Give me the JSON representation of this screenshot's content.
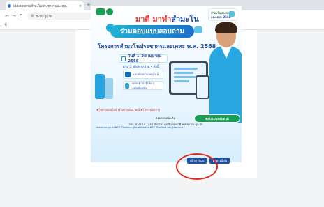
{
  "browser": {
    "tab_title": "แบบสอบถามสำมะโนประชากรและเคหะ",
    "tab_close": "×",
    "new_tab": "+",
    "back": "←",
    "forward": "→",
    "reload": "C",
    "address": "ระบบ.go.th",
    "apps_icon": "⠿"
  },
  "banner": {
    "logo_text": "สสช",
    "promo_line1": "สำมะโนประชากร",
    "promo_line2": "และเคหะ 2568",
    "headline_red": "มาดี",
    "headline_mid": " มาทำ",
    "headline_blue": "สำมะโน",
    "pill": "ร่วมตอบแบบสอบถาม",
    "subheadline": "โครงการสำมะโนประชากรและเคหะ พ.ศ. 2568",
    "date_text": "วันที่ 1–20 เมษายน 2568",
    "channels_label": "ผ่าน 3 ช่องทาง ง่าย ๆ ดังนี้",
    "option1": "แบบสอบถามออนไลน์",
    "option2": "สแกนคิวอาร์โค้ด / แอปพลิเคชัน",
    "footer_reds": "✖ไม่ทางออนไลน์  ✖ไม่ทางสัมภาษณ์  ✖ไม่ทางเอกสาร",
    "contact_line1": "สอบถามเพิ่มเติม",
    "contact_line2": "โทร. 0 2142 1234  สำนักงานสถิติแห่งชาติ  www.nso.go.th",
    "socials": "www.nso.go.th   NSO Thailand   @nsothailand   NSO Thailand   nso_thailand",
    "cta": "ตอบแบบสอบถาม",
    "icons": [
      "nso-logo-icon",
      "survey-icon",
      "chat-bubble-icon",
      "calendar-icon",
      "tablet-icon",
      "phone-icon",
      "person-mascot-icon"
    ]
  },
  "buttons": {
    "primary": "เข้าสู่ระบบ",
    "secondary": "ลงทะเบียน"
  },
  "annotation": {
    "highlight": "เข้าสู่ระบบ"
  }
}
